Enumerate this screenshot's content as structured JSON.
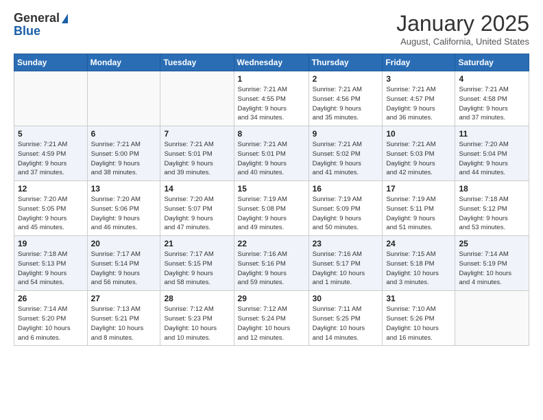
{
  "logo": {
    "line1": "General",
    "line2": "Blue"
  },
  "header": {
    "month": "January 2025",
    "location": "August, California, United States"
  },
  "weekdays": [
    "Sunday",
    "Monday",
    "Tuesday",
    "Wednesday",
    "Thursday",
    "Friday",
    "Saturday"
  ],
  "weeks": [
    [
      {
        "day": "",
        "info": ""
      },
      {
        "day": "",
        "info": ""
      },
      {
        "day": "",
        "info": ""
      },
      {
        "day": "1",
        "info": "Sunrise: 7:21 AM\nSunset: 4:55 PM\nDaylight: 9 hours\nand 34 minutes."
      },
      {
        "day": "2",
        "info": "Sunrise: 7:21 AM\nSunset: 4:56 PM\nDaylight: 9 hours\nand 35 minutes."
      },
      {
        "day": "3",
        "info": "Sunrise: 7:21 AM\nSunset: 4:57 PM\nDaylight: 9 hours\nand 36 minutes."
      },
      {
        "day": "4",
        "info": "Sunrise: 7:21 AM\nSunset: 4:58 PM\nDaylight: 9 hours\nand 37 minutes."
      }
    ],
    [
      {
        "day": "5",
        "info": "Sunrise: 7:21 AM\nSunset: 4:59 PM\nDaylight: 9 hours\nand 37 minutes."
      },
      {
        "day": "6",
        "info": "Sunrise: 7:21 AM\nSunset: 5:00 PM\nDaylight: 9 hours\nand 38 minutes."
      },
      {
        "day": "7",
        "info": "Sunrise: 7:21 AM\nSunset: 5:01 PM\nDaylight: 9 hours\nand 39 minutes."
      },
      {
        "day": "8",
        "info": "Sunrise: 7:21 AM\nSunset: 5:01 PM\nDaylight: 9 hours\nand 40 minutes."
      },
      {
        "day": "9",
        "info": "Sunrise: 7:21 AM\nSunset: 5:02 PM\nDaylight: 9 hours\nand 41 minutes."
      },
      {
        "day": "10",
        "info": "Sunrise: 7:21 AM\nSunset: 5:03 PM\nDaylight: 9 hours\nand 42 minutes."
      },
      {
        "day": "11",
        "info": "Sunrise: 7:20 AM\nSunset: 5:04 PM\nDaylight: 9 hours\nand 44 minutes."
      }
    ],
    [
      {
        "day": "12",
        "info": "Sunrise: 7:20 AM\nSunset: 5:05 PM\nDaylight: 9 hours\nand 45 minutes."
      },
      {
        "day": "13",
        "info": "Sunrise: 7:20 AM\nSunset: 5:06 PM\nDaylight: 9 hours\nand 46 minutes."
      },
      {
        "day": "14",
        "info": "Sunrise: 7:20 AM\nSunset: 5:07 PM\nDaylight: 9 hours\nand 47 minutes."
      },
      {
        "day": "15",
        "info": "Sunrise: 7:19 AM\nSunset: 5:08 PM\nDaylight: 9 hours\nand 49 minutes."
      },
      {
        "day": "16",
        "info": "Sunrise: 7:19 AM\nSunset: 5:09 PM\nDaylight: 9 hours\nand 50 minutes."
      },
      {
        "day": "17",
        "info": "Sunrise: 7:19 AM\nSunset: 5:11 PM\nDaylight: 9 hours\nand 51 minutes."
      },
      {
        "day": "18",
        "info": "Sunrise: 7:18 AM\nSunset: 5:12 PM\nDaylight: 9 hours\nand 53 minutes."
      }
    ],
    [
      {
        "day": "19",
        "info": "Sunrise: 7:18 AM\nSunset: 5:13 PM\nDaylight: 9 hours\nand 54 minutes."
      },
      {
        "day": "20",
        "info": "Sunrise: 7:17 AM\nSunset: 5:14 PM\nDaylight: 9 hours\nand 56 minutes."
      },
      {
        "day": "21",
        "info": "Sunrise: 7:17 AM\nSunset: 5:15 PM\nDaylight: 9 hours\nand 58 minutes."
      },
      {
        "day": "22",
        "info": "Sunrise: 7:16 AM\nSunset: 5:16 PM\nDaylight: 9 hours\nand 59 minutes."
      },
      {
        "day": "23",
        "info": "Sunrise: 7:16 AM\nSunset: 5:17 PM\nDaylight: 10 hours\nand 1 minute."
      },
      {
        "day": "24",
        "info": "Sunrise: 7:15 AM\nSunset: 5:18 PM\nDaylight: 10 hours\nand 3 minutes."
      },
      {
        "day": "25",
        "info": "Sunrise: 7:14 AM\nSunset: 5:19 PM\nDaylight: 10 hours\nand 4 minutes."
      }
    ],
    [
      {
        "day": "26",
        "info": "Sunrise: 7:14 AM\nSunset: 5:20 PM\nDaylight: 10 hours\nand 6 minutes."
      },
      {
        "day": "27",
        "info": "Sunrise: 7:13 AM\nSunset: 5:21 PM\nDaylight: 10 hours\nand 8 minutes."
      },
      {
        "day": "28",
        "info": "Sunrise: 7:12 AM\nSunset: 5:23 PM\nDaylight: 10 hours\nand 10 minutes."
      },
      {
        "day": "29",
        "info": "Sunrise: 7:12 AM\nSunset: 5:24 PM\nDaylight: 10 hours\nand 12 minutes."
      },
      {
        "day": "30",
        "info": "Sunrise: 7:11 AM\nSunset: 5:25 PM\nDaylight: 10 hours\nand 14 minutes."
      },
      {
        "day": "31",
        "info": "Sunrise: 7:10 AM\nSunset: 5:26 PM\nDaylight: 10 hours\nand 16 minutes."
      },
      {
        "day": "",
        "info": ""
      }
    ]
  ]
}
